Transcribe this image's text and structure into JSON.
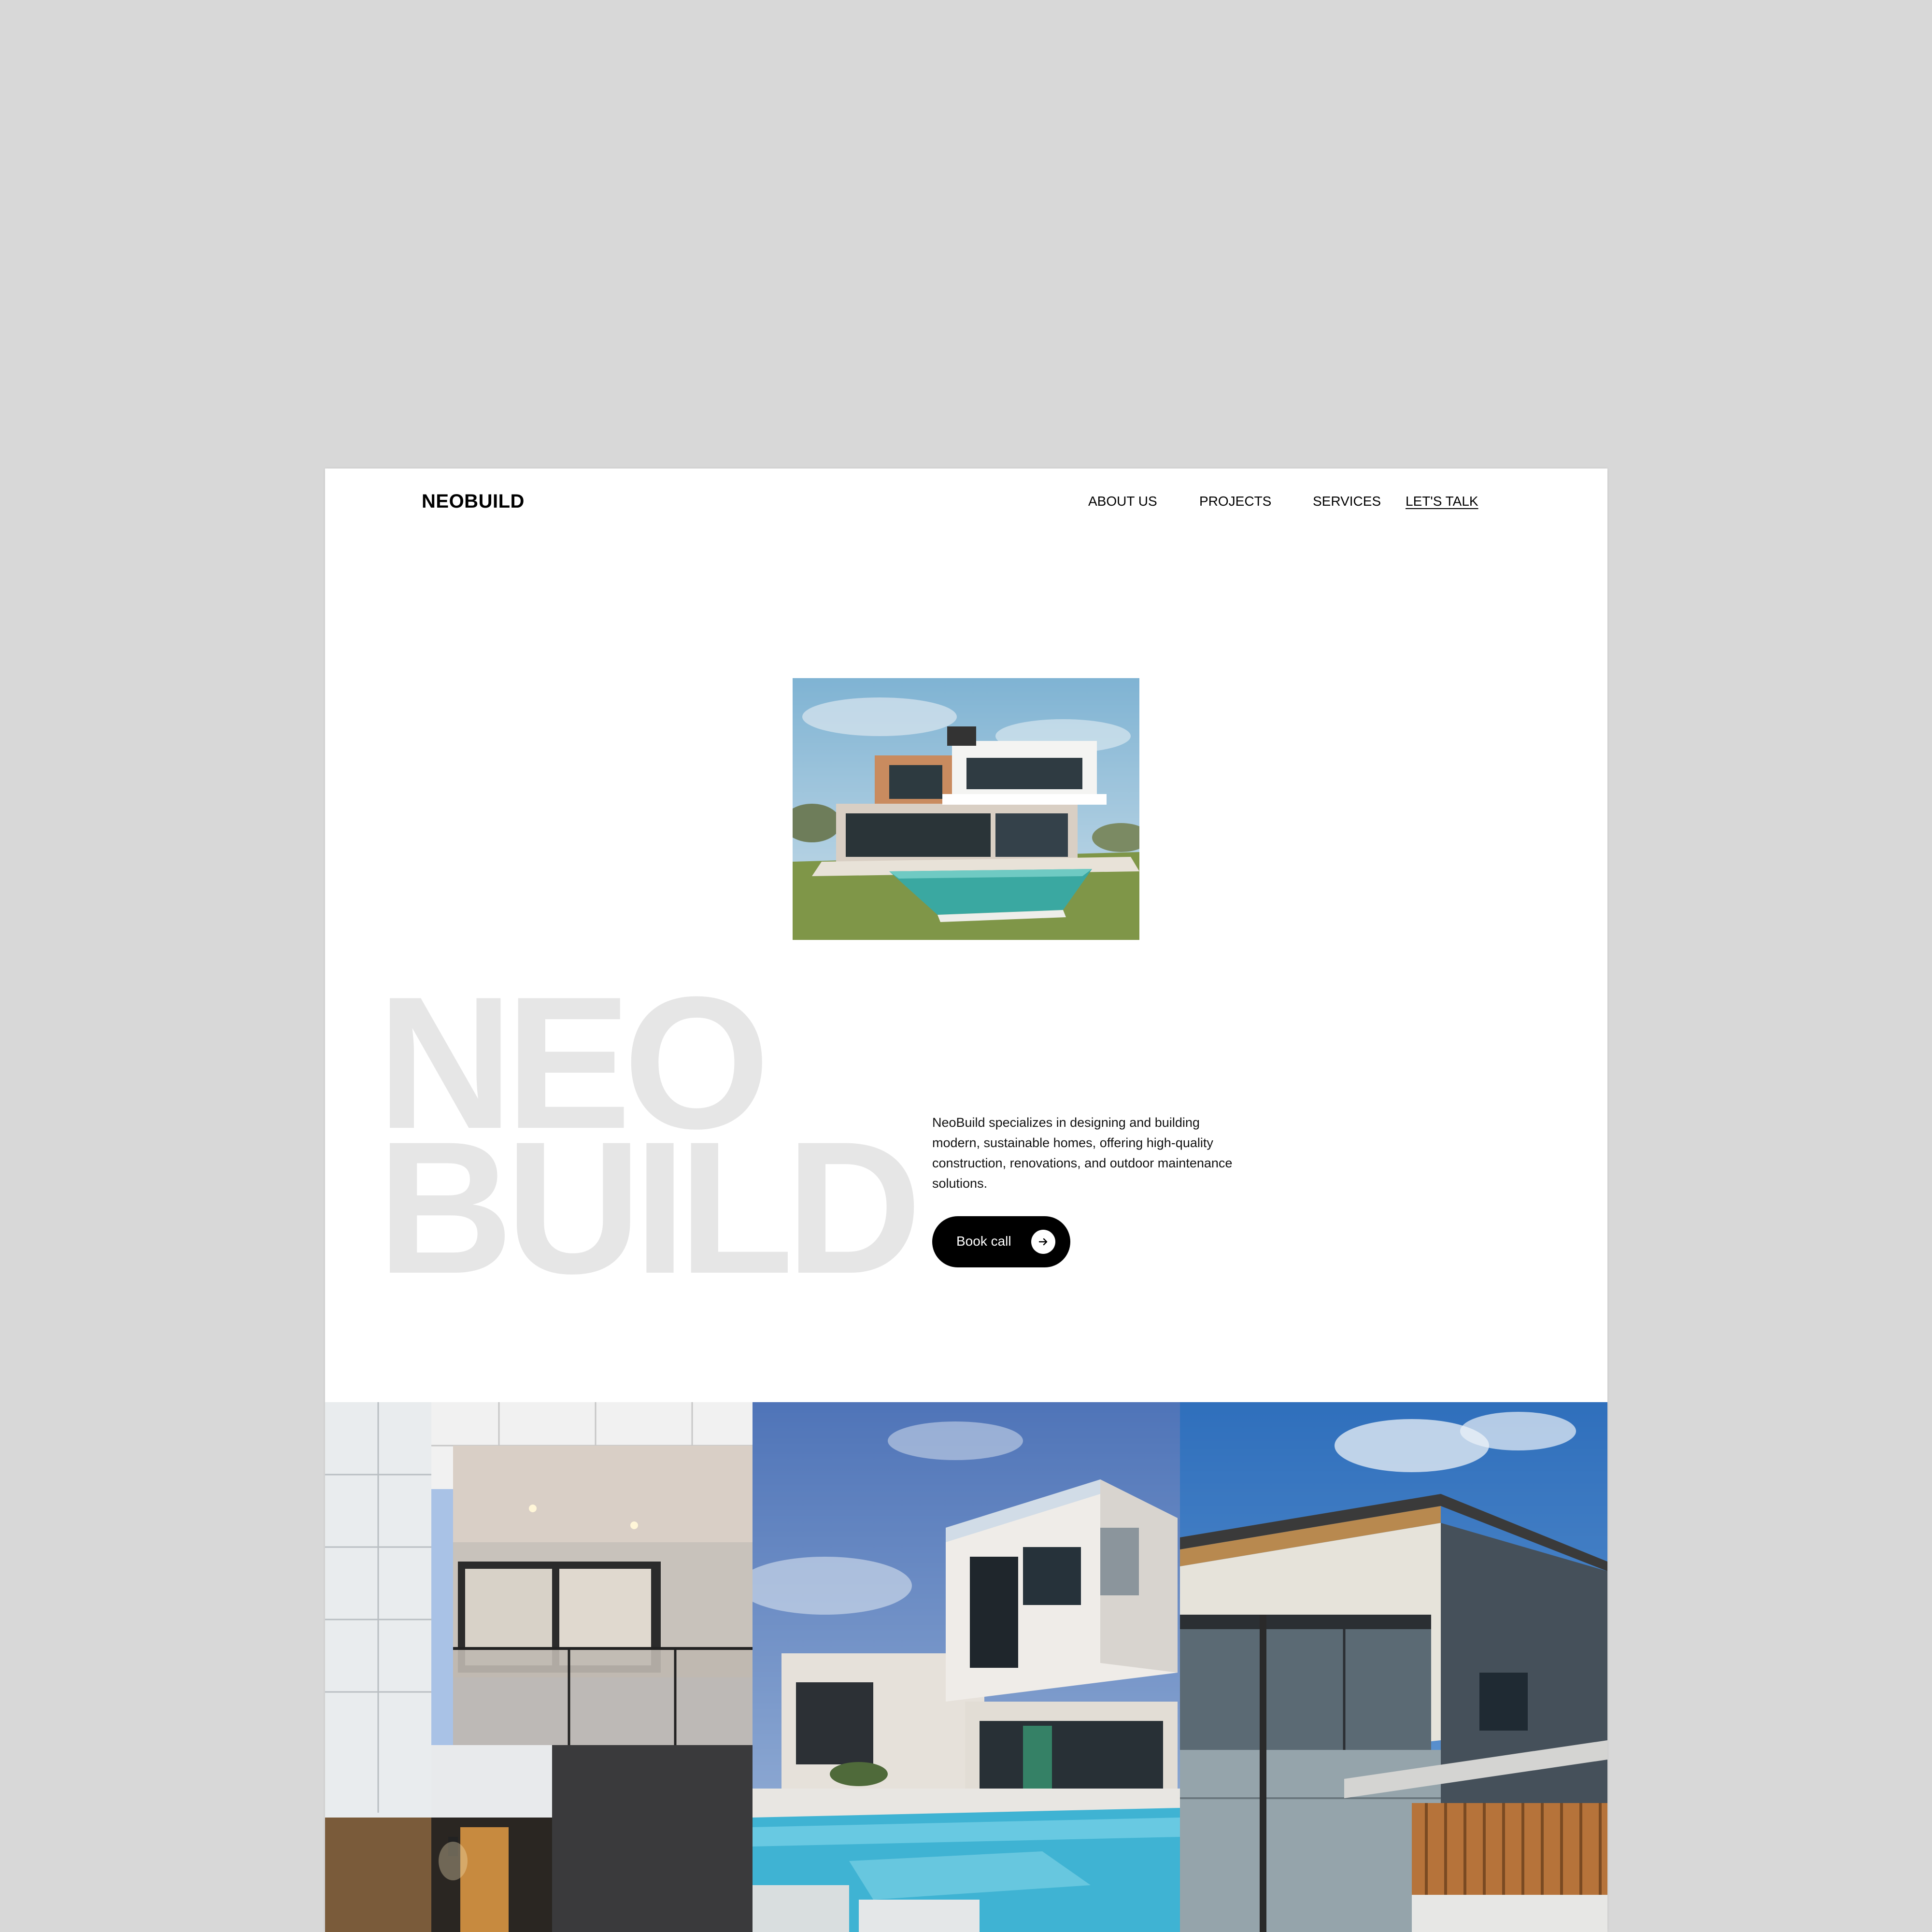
{
  "brand": {
    "logo": "NEOBUILD"
  },
  "nav": {
    "items": [
      "ABOUT US",
      "PROJECTS",
      "SERVICES"
    ],
    "cta": "LET'S TALK"
  },
  "hero": {
    "big_line1": "NEO",
    "big_line2": "BUILD",
    "description": "NeoBuild specializes in designing and building modern, sustainable homes, offering high-quality construction, renovations, and outdoor maintenance solutions.",
    "button_label": "Book call"
  },
  "colors": {
    "background": "#d8d8d8",
    "page": "#ffffff",
    "big_text": "#e6e6e6",
    "button": "#000000"
  },
  "icons": [
    "arrow-right-icon"
  ]
}
